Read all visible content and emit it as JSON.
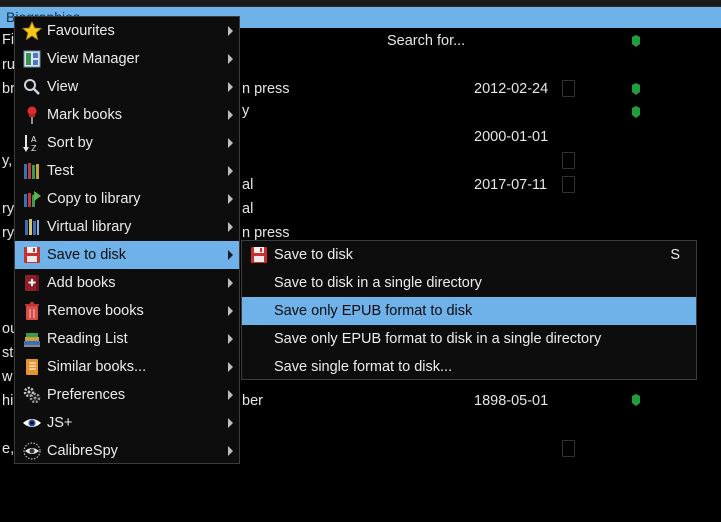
{
  "background": {
    "selected_row_text": "Biographies",
    "search_text": "Search for...",
    "left_fragments": [
      "Fi",
      "ru",
      "br",
      "y,",
      "ry",
      "ry",
      "ou",
      "sto",
      "w t",
      "hi",
      "e,"
    ],
    "publisher_fragments": [
      "n press",
      "y",
      "al",
      "al",
      "n press",
      "ber"
    ],
    "dates": [
      "2012-02-24",
      "2000-01-01",
      "2017-07-11",
      "1898-05-01"
    ]
  },
  "menu": {
    "items": [
      {
        "label": "Favourites",
        "icon": "star-icon"
      },
      {
        "label": "View Manager",
        "icon": "view-manager-icon"
      },
      {
        "label": "View",
        "icon": "magnifier-icon"
      },
      {
        "label": "Mark books",
        "icon": "pushpin-icon"
      },
      {
        "label": "Sort by",
        "icon": "sort-az-icon"
      },
      {
        "label": "Test",
        "icon": "books-icon"
      },
      {
        "label": "Copy to library",
        "icon": "copy-library-icon"
      },
      {
        "label": "Virtual library",
        "icon": "virtual-library-icon"
      },
      {
        "label": "Save to disk",
        "icon": "floppy-disk-icon"
      },
      {
        "label": "Add books",
        "icon": "add-book-icon"
      },
      {
        "label": "Remove books",
        "icon": "trash-icon"
      },
      {
        "label": "Reading List",
        "icon": "reading-list-icon"
      },
      {
        "label": "Similar books...",
        "icon": "similar-books-icon"
      },
      {
        "label": "Preferences",
        "icon": "gears-icon"
      },
      {
        "label": "JS+",
        "icon": "eye-icon"
      },
      {
        "label": "CalibreSpy",
        "icon": "spy-eye-icon"
      }
    ],
    "active_index": 8
  },
  "submenu": {
    "items": [
      {
        "label": "Save to disk",
        "shortcut": "S",
        "icon": "floppy-disk-icon"
      },
      {
        "label": "Save to disk in a single directory",
        "shortcut": ""
      },
      {
        "label": "Save only EPUB format to disk",
        "shortcut": ""
      },
      {
        "label": "Save only EPUB format to disk in a single directory",
        "shortcut": ""
      },
      {
        "label": "Save single format to disk...",
        "shortcut": ""
      }
    ],
    "active_index": 2
  },
  "colors": {
    "selection": "#6fb2ea",
    "evernote_green": "#1e9e3c",
    "menu_bg": "#0d0d0d"
  }
}
